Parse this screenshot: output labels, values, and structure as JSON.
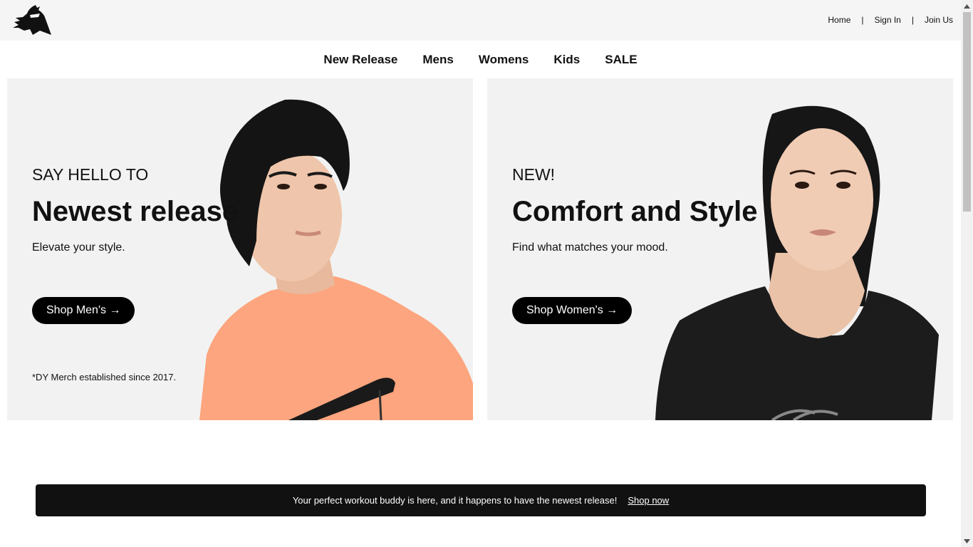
{
  "header": {
    "logo_icon": "ninja-logo-icon",
    "util_nav": [
      "Home",
      "Sign In",
      "Join Us"
    ],
    "separator": "|"
  },
  "nav": {
    "items": [
      "New Release",
      "Mens",
      "Womens",
      "Kids",
      "SALE"
    ]
  },
  "hero_left": {
    "eyebrow": "SAY HELLO TO",
    "headline": "Newest release",
    "sub": "Elevate your style.",
    "cta": "Shop Men's →",
    "footnote": "*DY Merch established since 2017."
  },
  "hero_right": {
    "eyebrow": "NEW!",
    "headline": "Comfort and Style",
    "sub": "Find what matches your mood.",
    "cta": "Shop Women's →"
  },
  "promo": {
    "text": "Your perfect workout buddy is here, and it happens to have the newest release!",
    "link": "Shop now"
  },
  "colors": {
    "topbar_bg": "#f5f5f5",
    "hero_bg": "#f2f2f2",
    "button_bg": "#000000",
    "promo_bg": "#111111",
    "men_shirt": "#fda57e",
    "women_shirt": "#1c1c1c"
  }
}
